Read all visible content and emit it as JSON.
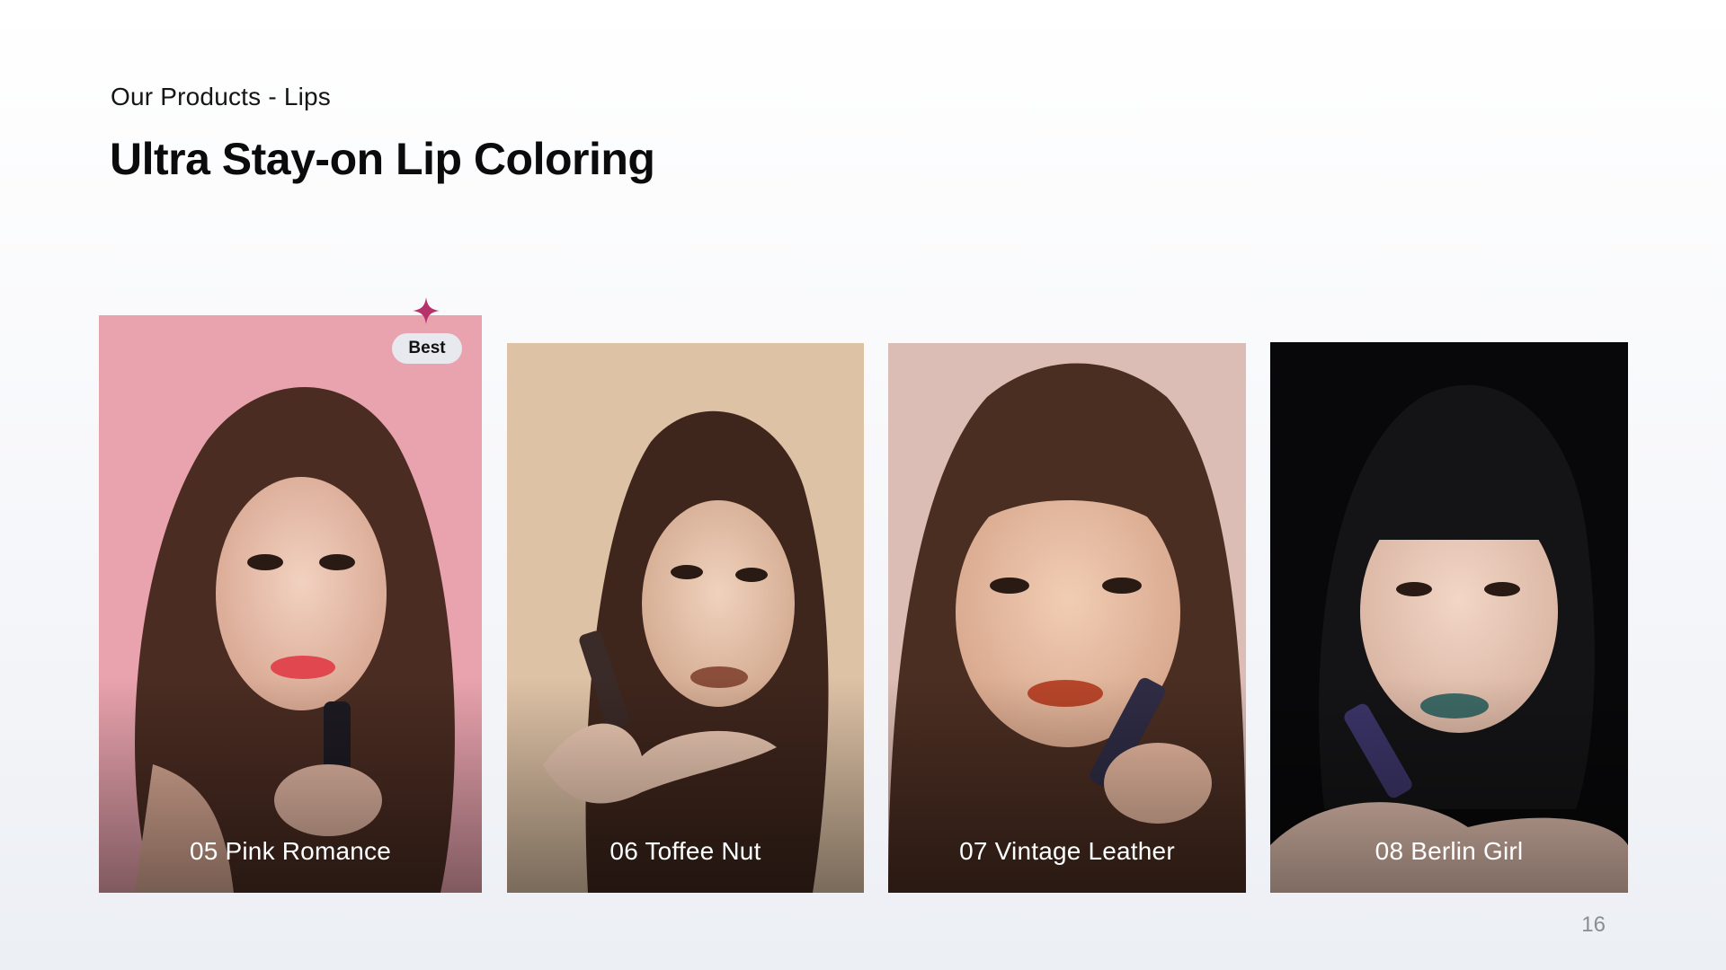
{
  "header": {
    "eyebrow": "Our Products - Lips",
    "title": "Ultra Stay-on Lip Coloring"
  },
  "products": [
    {
      "caption": "05 Pink Romance",
      "lip_color": "#e0474f",
      "background": "#e8a1ad",
      "badge": "Best"
    },
    {
      "caption": "06 Toffee Nut",
      "lip_color": "#8a4e3b",
      "background": "#dcbfa2"
    },
    {
      "caption": "07 Vintage Leather",
      "lip_color": "#b8462a",
      "background": "#d9bab3"
    },
    {
      "caption": "08 Berlin Girl",
      "lip_color": "#3e6a66",
      "background": "#080809"
    }
  ],
  "badge_accent": "#b5336a",
  "page_number": "16"
}
